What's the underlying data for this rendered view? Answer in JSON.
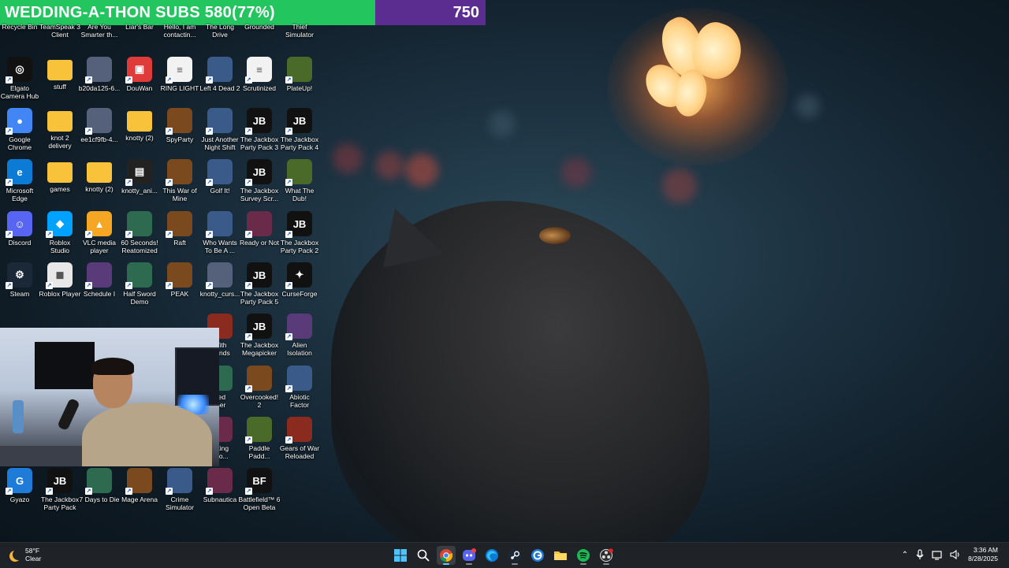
{
  "overlay": {
    "subs_text": "WEDDING-A-THON SUBS 580(77%)",
    "goal_value": "750",
    "colors": {
      "subs_bar": "#22c55e",
      "goal_bar": "#5c2d91"
    }
  },
  "desktop_icons": [
    {
      "label": "Recycle Bin",
      "icon": "recycle-bin-icon"
    },
    {
      "label": "TeamSpeak 3\nClient",
      "icon": "teamspeak-icon"
    },
    {
      "label": "Are You\nSmarter th...",
      "icon": "game-icon"
    },
    {
      "label": "Liar's Bar",
      "icon": "game-icon"
    },
    {
      "label": "Hello, I am\ncontactin...",
      "icon": "document-icon"
    },
    {
      "label": "The Long\nDrive",
      "icon": "game-icon"
    },
    {
      "label": "Grounded",
      "icon": "game-icon"
    },
    {
      "label": "Thief\nSimulator",
      "icon": "game-icon"
    },
    {
      "label": "Elgato\nCamera Hub",
      "icon": "elgato-icon"
    },
    {
      "label": "stuff",
      "icon": "folder-icon"
    },
    {
      "label": "b20da125-6...",
      "icon": "image-icon"
    },
    {
      "label": "DouWan",
      "icon": "douwan-icon"
    },
    {
      "label": "RING LIGHT",
      "icon": "document-icon"
    },
    {
      "label": "Left 4 Dead 2",
      "icon": "game-icon"
    },
    {
      "label": "Scrutinized",
      "icon": "document-icon"
    },
    {
      "label": "PlateUp!",
      "icon": "game-icon"
    },
    {
      "label": "Google\nChrome",
      "icon": "chrome-icon"
    },
    {
      "label": "knot 2\ndelivery",
      "icon": "folder-icon"
    },
    {
      "label": "ee1cf9fb-4...",
      "icon": "image-icon"
    },
    {
      "label": "knotty (2)",
      "icon": "folder-icon"
    },
    {
      "label": "SpyParty",
      "icon": "game-icon"
    },
    {
      "label": "Just Another\nNight Shift",
      "icon": "game-icon"
    },
    {
      "label": "The Jackbox\nParty Pack 3",
      "icon": "jackbox-icon"
    },
    {
      "label": "The Jackbox\nParty Pack 4",
      "icon": "jackbox-icon"
    },
    {
      "label": "Microsoft\nEdge",
      "icon": "edge-icon"
    },
    {
      "label": "games",
      "icon": "folder-icon"
    },
    {
      "label": "knotty (2)",
      "icon": "folder-icon"
    },
    {
      "label": "knotty_ani...",
      "icon": "video-icon"
    },
    {
      "label": "This War of\nMine",
      "icon": "game-icon"
    },
    {
      "label": "Golf It!",
      "icon": "game-icon"
    },
    {
      "label": "The Jackbox\nSurvey Scr...",
      "icon": "jackbox-icon"
    },
    {
      "label": "What The\nDub!",
      "icon": "game-icon"
    },
    {
      "label": "Discord",
      "icon": "discord-icon"
    },
    {
      "label": "Roblox\nStudio",
      "icon": "roblox-studio-icon"
    },
    {
      "label": "VLC media\nplayer",
      "icon": "vlc-icon"
    },
    {
      "label": "60 Seconds!\nReatomized",
      "icon": "game-icon"
    },
    {
      "label": "Raft",
      "icon": "game-icon"
    },
    {
      "label": "Who Wants\nTo Be A ...",
      "icon": "game-icon"
    },
    {
      "label": "Ready or Not",
      "icon": "game-icon"
    },
    {
      "label": "The Jackbox\nParty Pack 2",
      "icon": "jackbox-icon"
    },
    {
      "label": "Steam",
      "icon": "steam-icon"
    },
    {
      "label": "Roblox Player",
      "icon": "roblox-icon"
    },
    {
      "label": "Schedule I",
      "icon": "game-icon"
    },
    {
      "label": "Half Sword\nDemo",
      "icon": "game-icon"
    },
    {
      "label": "PEAK",
      "icon": "game-icon"
    },
    {
      "label": "knotty_curs...",
      "icon": "image-icon"
    },
    {
      "label": "The Jackbox\nParty Pack 5",
      "icon": "jackbox-icon"
    },
    {
      "label": "CurseForge",
      "icon": "curseforge-icon"
    },
    {
      "label": "With\nfriends",
      "icon": "game-icon"
    },
    {
      "label": "The Jackbox\nMegapicker",
      "icon": "jackbox-icon"
    },
    {
      "label": "Alien\nIsolation",
      "icon": "game-icon"
    },
    {
      "label": "ned\nther",
      "icon": "game-icon"
    },
    {
      "label": "Overcooked!\n2",
      "icon": "game-icon"
    },
    {
      "label": "Abiotic\nFactor",
      "icon": "game-icon"
    },
    {
      "label": "alking\nobo...",
      "icon": "game-icon"
    },
    {
      "label": "Paddle\nPadd...",
      "icon": "game-icon"
    },
    {
      "label": "Gears of War\nReloaded",
      "icon": "game-icon"
    },
    {
      "label": "Gyazo",
      "icon": "gyazo-icon"
    },
    {
      "label": "The Jackbox\nParty Pack",
      "icon": "jackbox-icon"
    },
    {
      "label": "7 Days to Die",
      "icon": "game-icon"
    },
    {
      "label": "Mage Arena",
      "icon": "game-icon"
    },
    {
      "label": "Crime\nSimulator",
      "icon": "game-icon"
    },
    {
      "label": "Subnautica",
      "icon": "game-icon"
    },
    {
      "label": "Battlefield™ 6\nOpen Beta",
      "icon": "battlefield-icon"
    }
  ],
  "taskbar": {
    "weather_temp": "58°F",
    "weather_cond": "Clear",
    "apps": [
      {
        "name": "start-icon"
      },
      {
        "name": "search-icon"
      },
      {
        "name": "chrome-icon"
      },
      {
        "name": "discord-icon"
      },
      {
        "name": "edge-icon"
      },
      {
        "name": "steam-icon"
      },
      {
        "name": "gyazo-icon"
      },
      {
        "name": "file-explorer-icon"
      },
      {
        "name": "spotify-icon"
      },
      {
        "name": "obs-icon"
      }
    ],
    "time": "3:36 AM",
    "date": "8/28/2025"
  }
}
